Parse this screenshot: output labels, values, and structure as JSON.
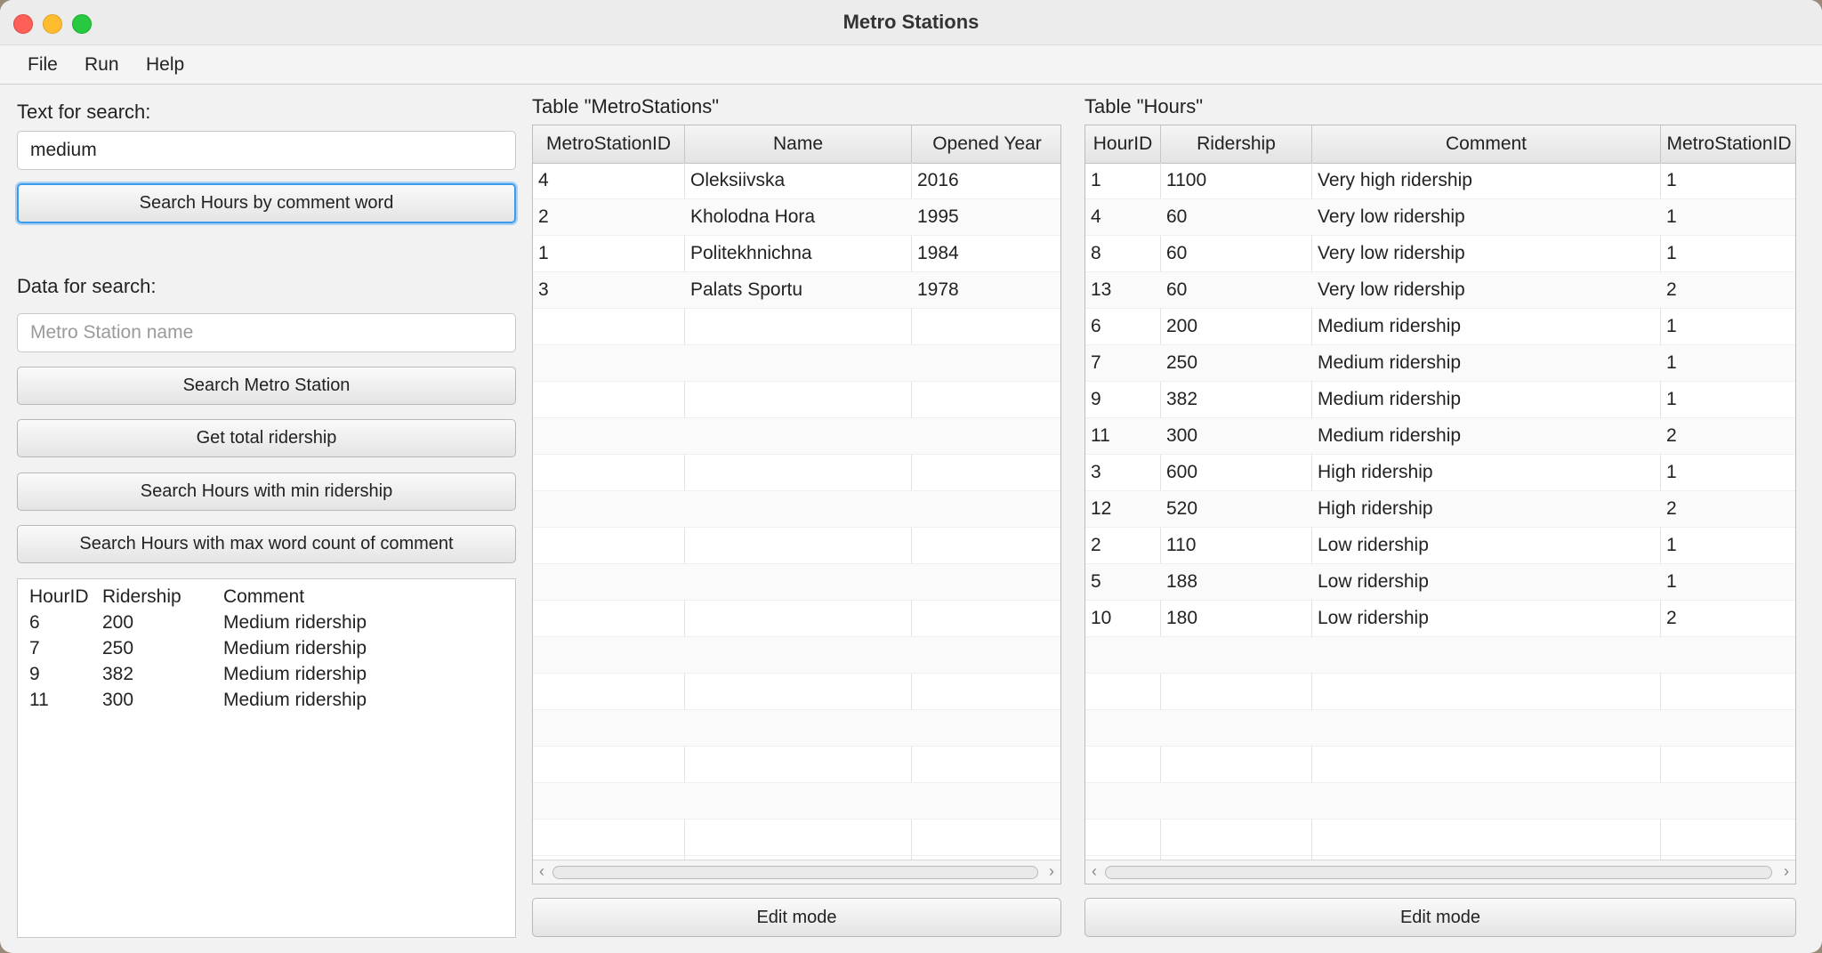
{
  "window": {
    "title": "Metro Stations"
  },
  "menu": {
    "file": "File",
    "run": "Run",
    "help": "Help"
  },
  "left": {
    "search_text_label": "Text for search:",
    "search_text_value": "medium",
    "search_hours_button": "Search Hours by comment word",
    "data_search_label": "Data for search:",
    "station_name_placeholder": "Metro Station name",
    "search_station_button": "Search Metro Station",
    "total_ridership_button": "Get total ridership",
    "min_ridership_button": "Search Hours with min ridership",
    "max_word_button": "Search Hours with max word count of comment",
    "result": {
      "headers": [
        "HourID",
        "Ridership",
        "Comment"
      ],
      "rows": [
        [
          "6",
          "200",
          "Medium ridership"
        ],
        [
          "7",
          "250",
          "Medium ridership"
        ],
        [
          "9",
          "382",
          "Medium ridership"
        ],
        [
          "11",
          "300",
          "Medium ridership"
        ]
      ]
    }
  },
  "stations_table": {
    "title": "Table \"MetroStations\"",
    "columns": [
      "MetroStationID",
      "Name",
      "Opened Year"
    ],
    "rows": [
      [
        "4",
        "Oleksiivska",
        "2016"
      ],
      [
        "2",
        "Kholodna Hora",
        "1995"
      ],
      [
        "1",
        "Politekhnichna",
        "1984"
      ],
      [
        "3",
        "Palats Sportu",
        "1978"
      ]
    ],
    "edit_button": "Edit mode"
  },
  "hours_table": {
    "title": "Table \"Hours\"",
    "columns": [
      "HourID",
      "Ridership",
      "Comment",
      "MetroStationID"
    ],
    "rows": [
      [
        "1",
        "1100",
        "Very high ridership",
        "1"
      ],
      [
        "4",
        "60",
        "Very low ridership",
        "1"
      ],
      [
        "8",
        "60",
        "Very low ridership",
        "1"
      ],
      [
        "13",
        "60",
        "Very low ridership",
        "2"
      ],
      [
        "6",
        "200",
        "Medium ridership",
        "1"
      ],
      [
        "7",
        "250",
        "Medium ridership",
        "1"
      ],
      [
        "9",
        "382",
        "Medium ridership",
        "1"
      ],
      [
        "11",
        "300",
        "Medium ridership",
        "2"
      ],
      [
        "3",
        "600",
        "High ridership",
        "1"
      ],
      [
        "12",
        "520",
        "High ridership",
        "2"
      ],
      [
        "2",
        "110",
        "Low ridership",
        "1"
      ],
      [
        "5",
        "188",
        "Low ridership",
        "1"
      ],
      [
        "10",
        "180",
        "Low ridership",
        "2"
      ]
    ],
    "edit_button": "Edit mode"
  }
}
